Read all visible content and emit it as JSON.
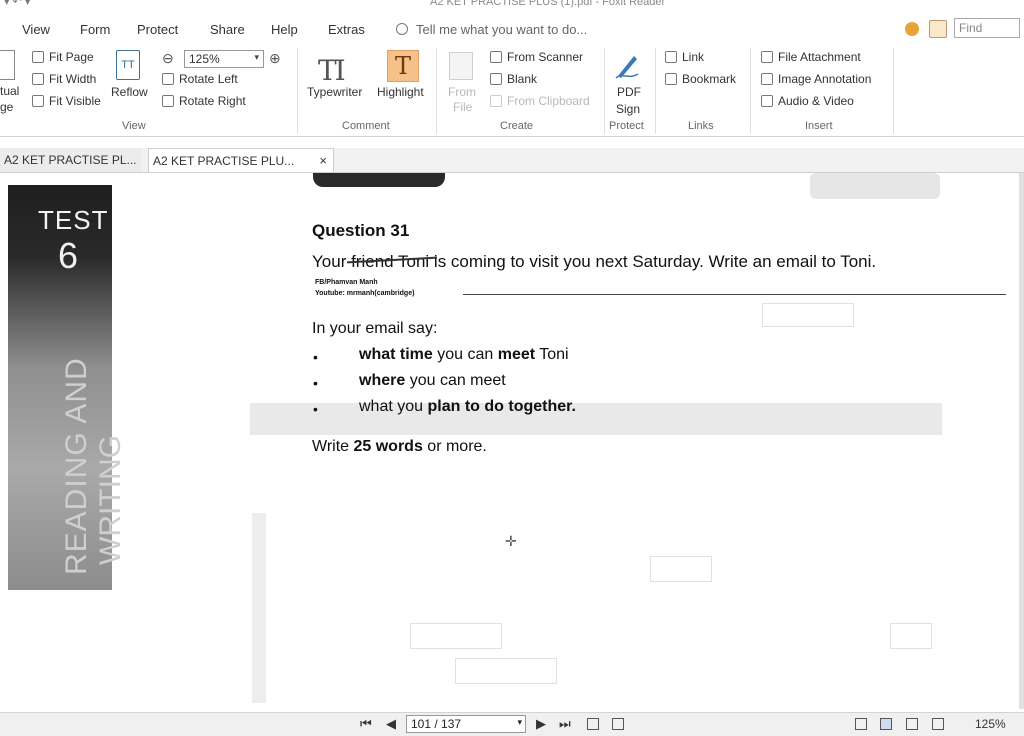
{
  "window": {
    "title": "A2 KET PRACTISE PLUS (1).pdf - Foxit Reader"
  },
  "menu": {
    "items": [
      "View",
      "Form",
      "Protect",
      "Share",
      "Help",
      "Extras"
    ],
    "tell_me": "Tell me what you want to do...",
    "find_placeholder": "Find"
  },
  "ribbon": {
    "view": {
      "left_cut_1": "tual",
      "left_cut_2": "ge",
      "fit_page": "Fit Page",
      "fit_width": "Fit Width",
      "fit_visible": "Fit Visible",
      "reflow": "Reflow",
      "zoom_value": "125%",
      "rotate_left": "Rotate Left",
      "rotate_right": "Rotate Right",
      "group_label": "View"
    },
    "comment": {
      "typewriter": "Typewriter",
      "highlight": "Highlight",
      "group_label": "Comment"
    },
    "create": {
      "from_file_1": "From",
      "from_file_2": "File",
      "from_scanner": "From Scanner",
      "blank": "Blank",
      "from_clipboard": "From Clipboard",
      "group_label": "Create"
    },
    "protect": {
      "pdf_sign_1": "PDF",
      "pdf_sign_2": "Sign",
      "group_label": "Protect"
    },
    "links": {
      "link": "Link",
      "bookmark": "Bookmark",
      "group_label": "Links"
    },
    "insert": {
      "file_attachment": "File Attachment",
      "image_annotation": "Image Annotation",
      "audio_video": "Audio & Video",
      "group_label": "Insert"
    }
  },
  "tabs": [
    {
      "label": "A2 KET PRACTISE PL..."
    },
    {
      "label": "A2 KET PRACTISE PLU...",
      "close": "×"
    }
  ],
  "document": {
    "sidebar_test": "TEST",
    "sidebar_number": "6",
    "sidebar_vertical_1": "READING AND",
    "sidebar_vertical_2": "WRITING",
    "question_title": "Question 31",
    "question_text": "Your friend Toni is coming to visit you next Saturday. Write an email to Toni.",
    "credit_line_1": "FB/Phamvan Manh",
    "credit_line_2": "Youtube: mrmanh(cambridge)",
    "email_say": "In your email say:",
    "bullets": [
      {
        "bold1": "what time",
        "mid": " you can ",
        "bold2": "meet",
        "end": " Toni"
      },
      {
        "bold1": "where",
        "mid": " you can meet",
        "bold2": "",
        "end": ""
      },
      {
        "bold1": "",
        "mid": "what you ",
        "bold2": "plan to do together.",
        "end": ""
      }
    ],
    "bullet_glyph": "•",
    "write_prefix": "Write ",
    "write_bold": "25 words",
    "write_suffix": " or more."
  },
  "statusbar": {
    "page_indicator": "101 / 137",
    "zoom": "125%"
  }
}
